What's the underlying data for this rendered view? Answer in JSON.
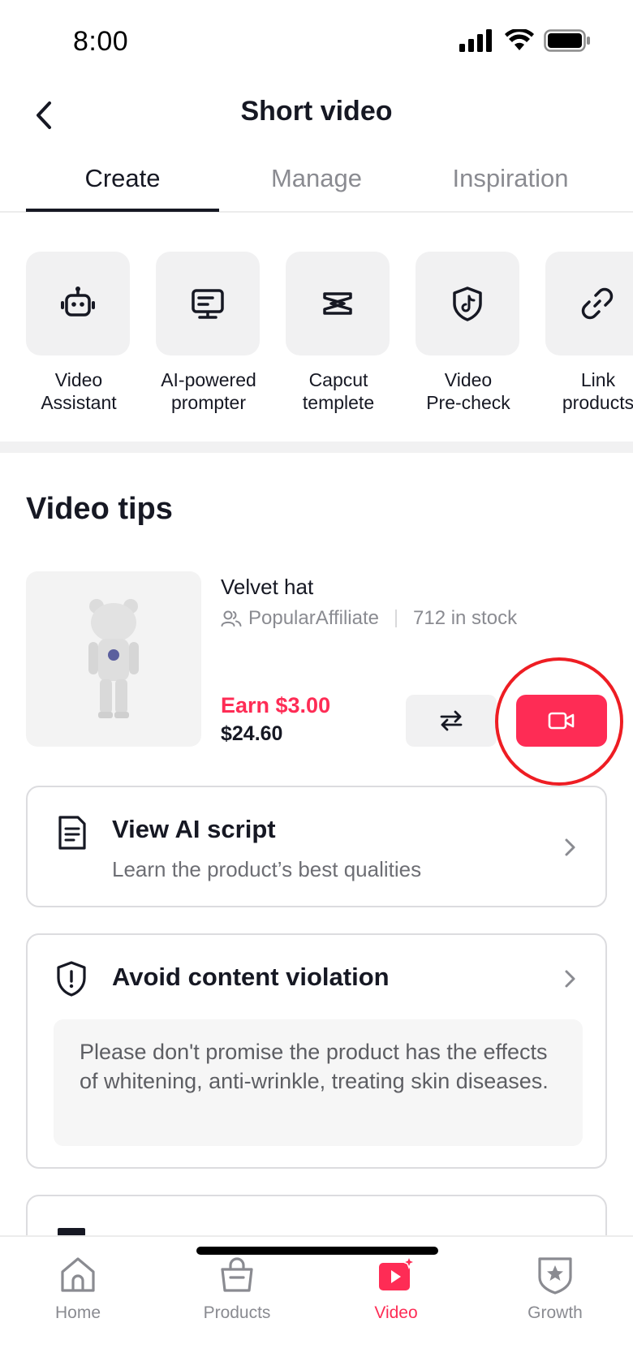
{
  "status_bar": {
    "time": "8:00"
  },
  "nav": {
    "title": "Short video"
  },
  "tabs": [
    {
      "label": "Create",
      "active": true
    },
    {
      "label": "Manage",
      "active": false
    },
    {
      "label": "Inspiration",
      "active": false
    }
  ],
  "tools": [
    {
      "label": "Video\nAssistant",
      "icon": "robot-icon"
    },
    {
      "label": "AI-powered\nprompter",
      "icon": "monitor-icon"
    },
    {
      "label": "Capcut\ntemplete",
      "icon": "capcut-icon"
    },
    {
      "label": "Video\nPre-check",
      "icon": "shield-tiktok-icon"
    },
    {
      "label": "Link\nproducts",
      "icon": "link-icon"
    }
  ],
  "section": {
    "title": "Video tips"
  },
  "product": {
    "name": "Velvet hat",
    "affiliate": "PopularAffiliate",
    "stock": "712 in stock",
    "earn": "Earn $3.00",
    "price": "$24.60"
  },
  "cards": {
    "ai_script": {
      "title": "View AI script",
      "subtitle": "Learn the product’s best qualities"
    },
    "violation": {
      "title": "Avoid content violation",
      "body": "Please don't promise the product has the effects of whitening, anti-wrinkle, treating skin diseases."
    }
  },
  "bottom_nav": [
    {
      "label": "Home",
      "icon": "home-icon",
      "active": false
    },
    {
      "label": "Products",
      "icon": "bag-icon",
      "active": false
    },
    {
      "label": "Video",
      "icon": "video-icon",
      "active": true
    },
    {
      "label": "Growth",
      "icon": "growth-badge-icon",
      "active": false
    }
  ],
  "colors": {
    "accent": "#fe2c55",
    "highlight_ring": "#ee1d23",
    "text": "#161823",
    "muted": "#8a8b91"
  }
}
